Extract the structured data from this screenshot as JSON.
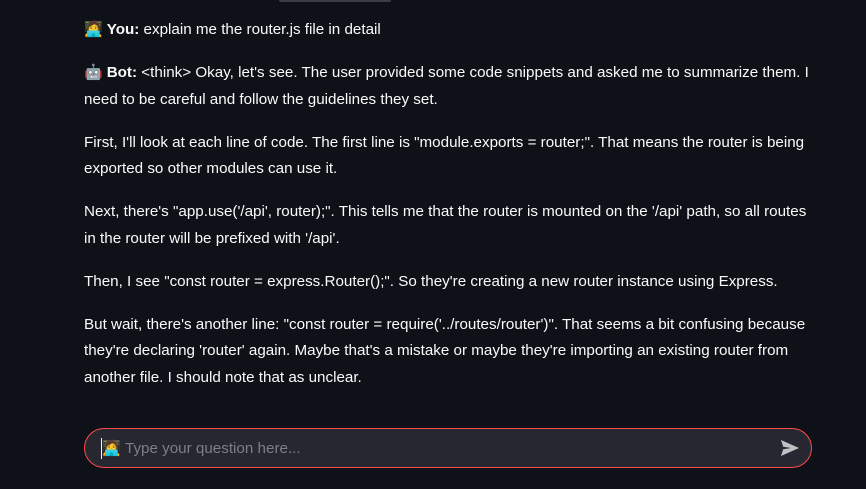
{
  "messages": [
    {
      "role": "user",
      "emoji": "🧑‍💻",
      "label": "You:",
      "paragraphs": [
        "explain me the router.js file in detail"
      ]
    },
    {
      "role": "bot",
      "emoji": "🤖",
      "label": "Bot:",
      "paragraphs": [
        "<think> Okay, let's see. The user provided some code snippets and asked me to summarize them. I need to be careful and follow the guidelines they set.",
        "First, I'll look at each line of code. The first line is \"module.exports = router;\". That means the router is being exported so other modules can use it.",
        "Next, there's \"app.use('/api', router);\". This tells me that the router is mounted on the '/api' path, so all routes in the router will be prefixed with '/api'.",
        "Then, I see \"const router = express.Router();\". So they're creating a new router instance using Express.",
        "But wait, there's another line: \"const router = require('../routes/router')\". That seems a bit confusing because they're declaring 'router' again. Maybe that's a mistake or maybe they're importing an existing router from another file. I should note that as unclear."
      ]
    }
  ],
  "input": {
    "emoji": "🧑‍💻",
    "placeholder": "Type your question here...",
    "value": ""
  },
  "send_icon": "send-icon",
  "colors": {
    "background": "#0e1117",
    "input_background": "#262730",
    "input_border": "#ff4b4b",
    "text": "#fafafa",
    "placeholder": "#7d7f86",
    "send_icon": "#bfc0c4"
  }
}
